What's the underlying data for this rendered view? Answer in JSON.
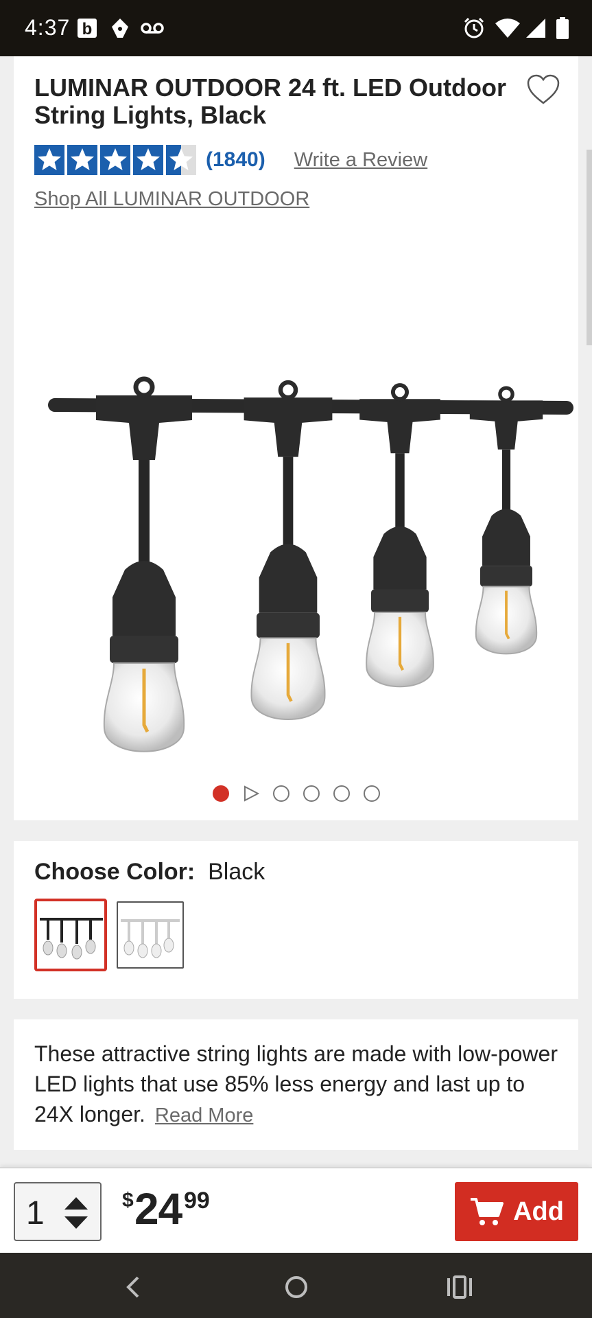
{
  "status_bar": {
    "time": "4:37",
    "left_icons": [
      "b-notification-icon",
      "pen-icon",
      "voicemail-icon"
    ],
    "right_icons": [
      "alarm-icon",
      "wifi-icon",
      "cell-signal-icon",
      "battery-icon"
    ],
    "b_glyph": "b"
  },
  "product": {
    "brand": "LUMINAR OUTDOOR",
    "name": " 24 ft. LED Outdoor String Lights, Black",
    "rating": 4.5,
    "review_count": "(1840)",
    "write_review": "Write a Review",
    "shop_all": "Shop All LUMINAR OUTDOOR",
    "image_count": 6,
    "active_image": 1
  },
  "color": {
    "label": "Choose Color:",
    "selected": "Black",
    "options": [
      "Black",
      "White"
    ]
  },
  "description": {
    "text": "These attractive string lights are made with low-power LED lights that use 85% less energy and last up to 24X longer.",
    "read_more": "Read More"
  },
  "purchase": {
    "quantity": "1",
    "currency": "$",
    "price_dollars": "24",
    "price_cents": "99",
    "add_label": "Add"
  },
  "colors": {
    "accent_red": "#d22d22",
    "link_blue": "#1b5fad",
    "status_bar": "#17140f"
  }
}
